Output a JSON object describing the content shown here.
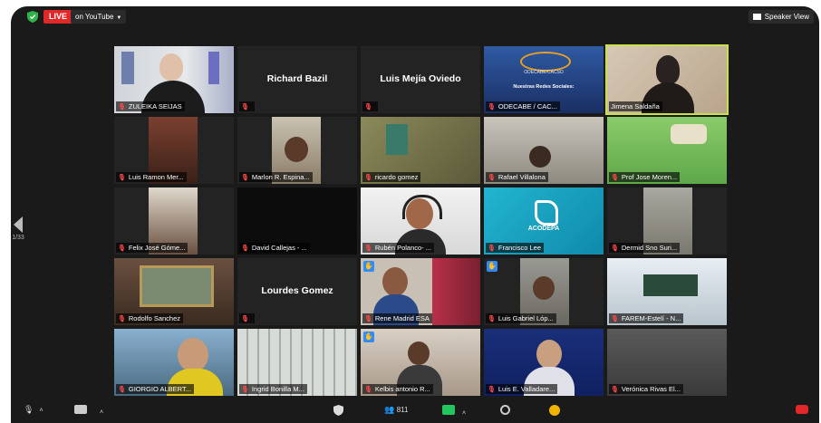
{
  "topbar": {
    "live_label": "LIVE",
    "stream_label": "on YouTube",
    "speaker_view_label": "Speaker View"
  },
  "pager": {
    "left_count": "1/33"
  },
  "tiles": [
    {
      "name": "ZULEIKA SEIJAS"
    },
    {
      "name": "Richard Bazil"
    },
    {
      "name": "Luis Mejía Oviedo"
    },
    {
      "name": "ODECABE / CAC...",
      "logo_text": "ODECABE/CACSO",
      "logo_sub": "Nuestras Redes Sociales:"
    },
    {
      "name": "Jimena Saldaña"
    },
    {
      "name": "Luis Ramon Mer..."
    },
    {
      "name": "Marlon R. Espina..."
    },
    {
      "name": "ricardo gomez"
    },
    {
      "name": "Rafael Villalona"
    },
    {
      "name": "Prof Jose Moren..."
    },
    {
      "name": "Felix José Góme..."
    },
    {
      "name": "David Callejas - ..."
    },
    {
      "name": "Rubén Polanco- ..."
    },
    {
      "name": "Francisco Lee",
      "logo_text": "ACODEPA"
    },
    {
      "name": "Dermid Sno Suri..."
    },
    {
      "name": "Rodolfo Sanchez"
    },
    {
      "name": "Lourdes Gomez"
    },
    {
      "name": "Rene Madrid ESA"
    },
    {
      "name": "Luis Gabriel Lóp..."
    },
    {
      "name": "FAREM-Estelí - N..."
    },
    {
      "name": "GIORGIO ALBERT..."
    },
    {
      "name": "Ingrid Bonilla M..."
    },
    {
      "name": "Kelbis antonio R..."
    },
    {
      "name": "Luis E. Valladare..."
    },
    {
      "name": "Verónica Rivas El..."
    }
  ],
  "toolbar": {
    "participants_count": "811"
  },
  "colors": {
    "live": "#e02828",
    "active_speaker": "#c8e04a",
    "raise_hand": "#2d8cff",
    "muted": "#ff4a4a"
  }
}
